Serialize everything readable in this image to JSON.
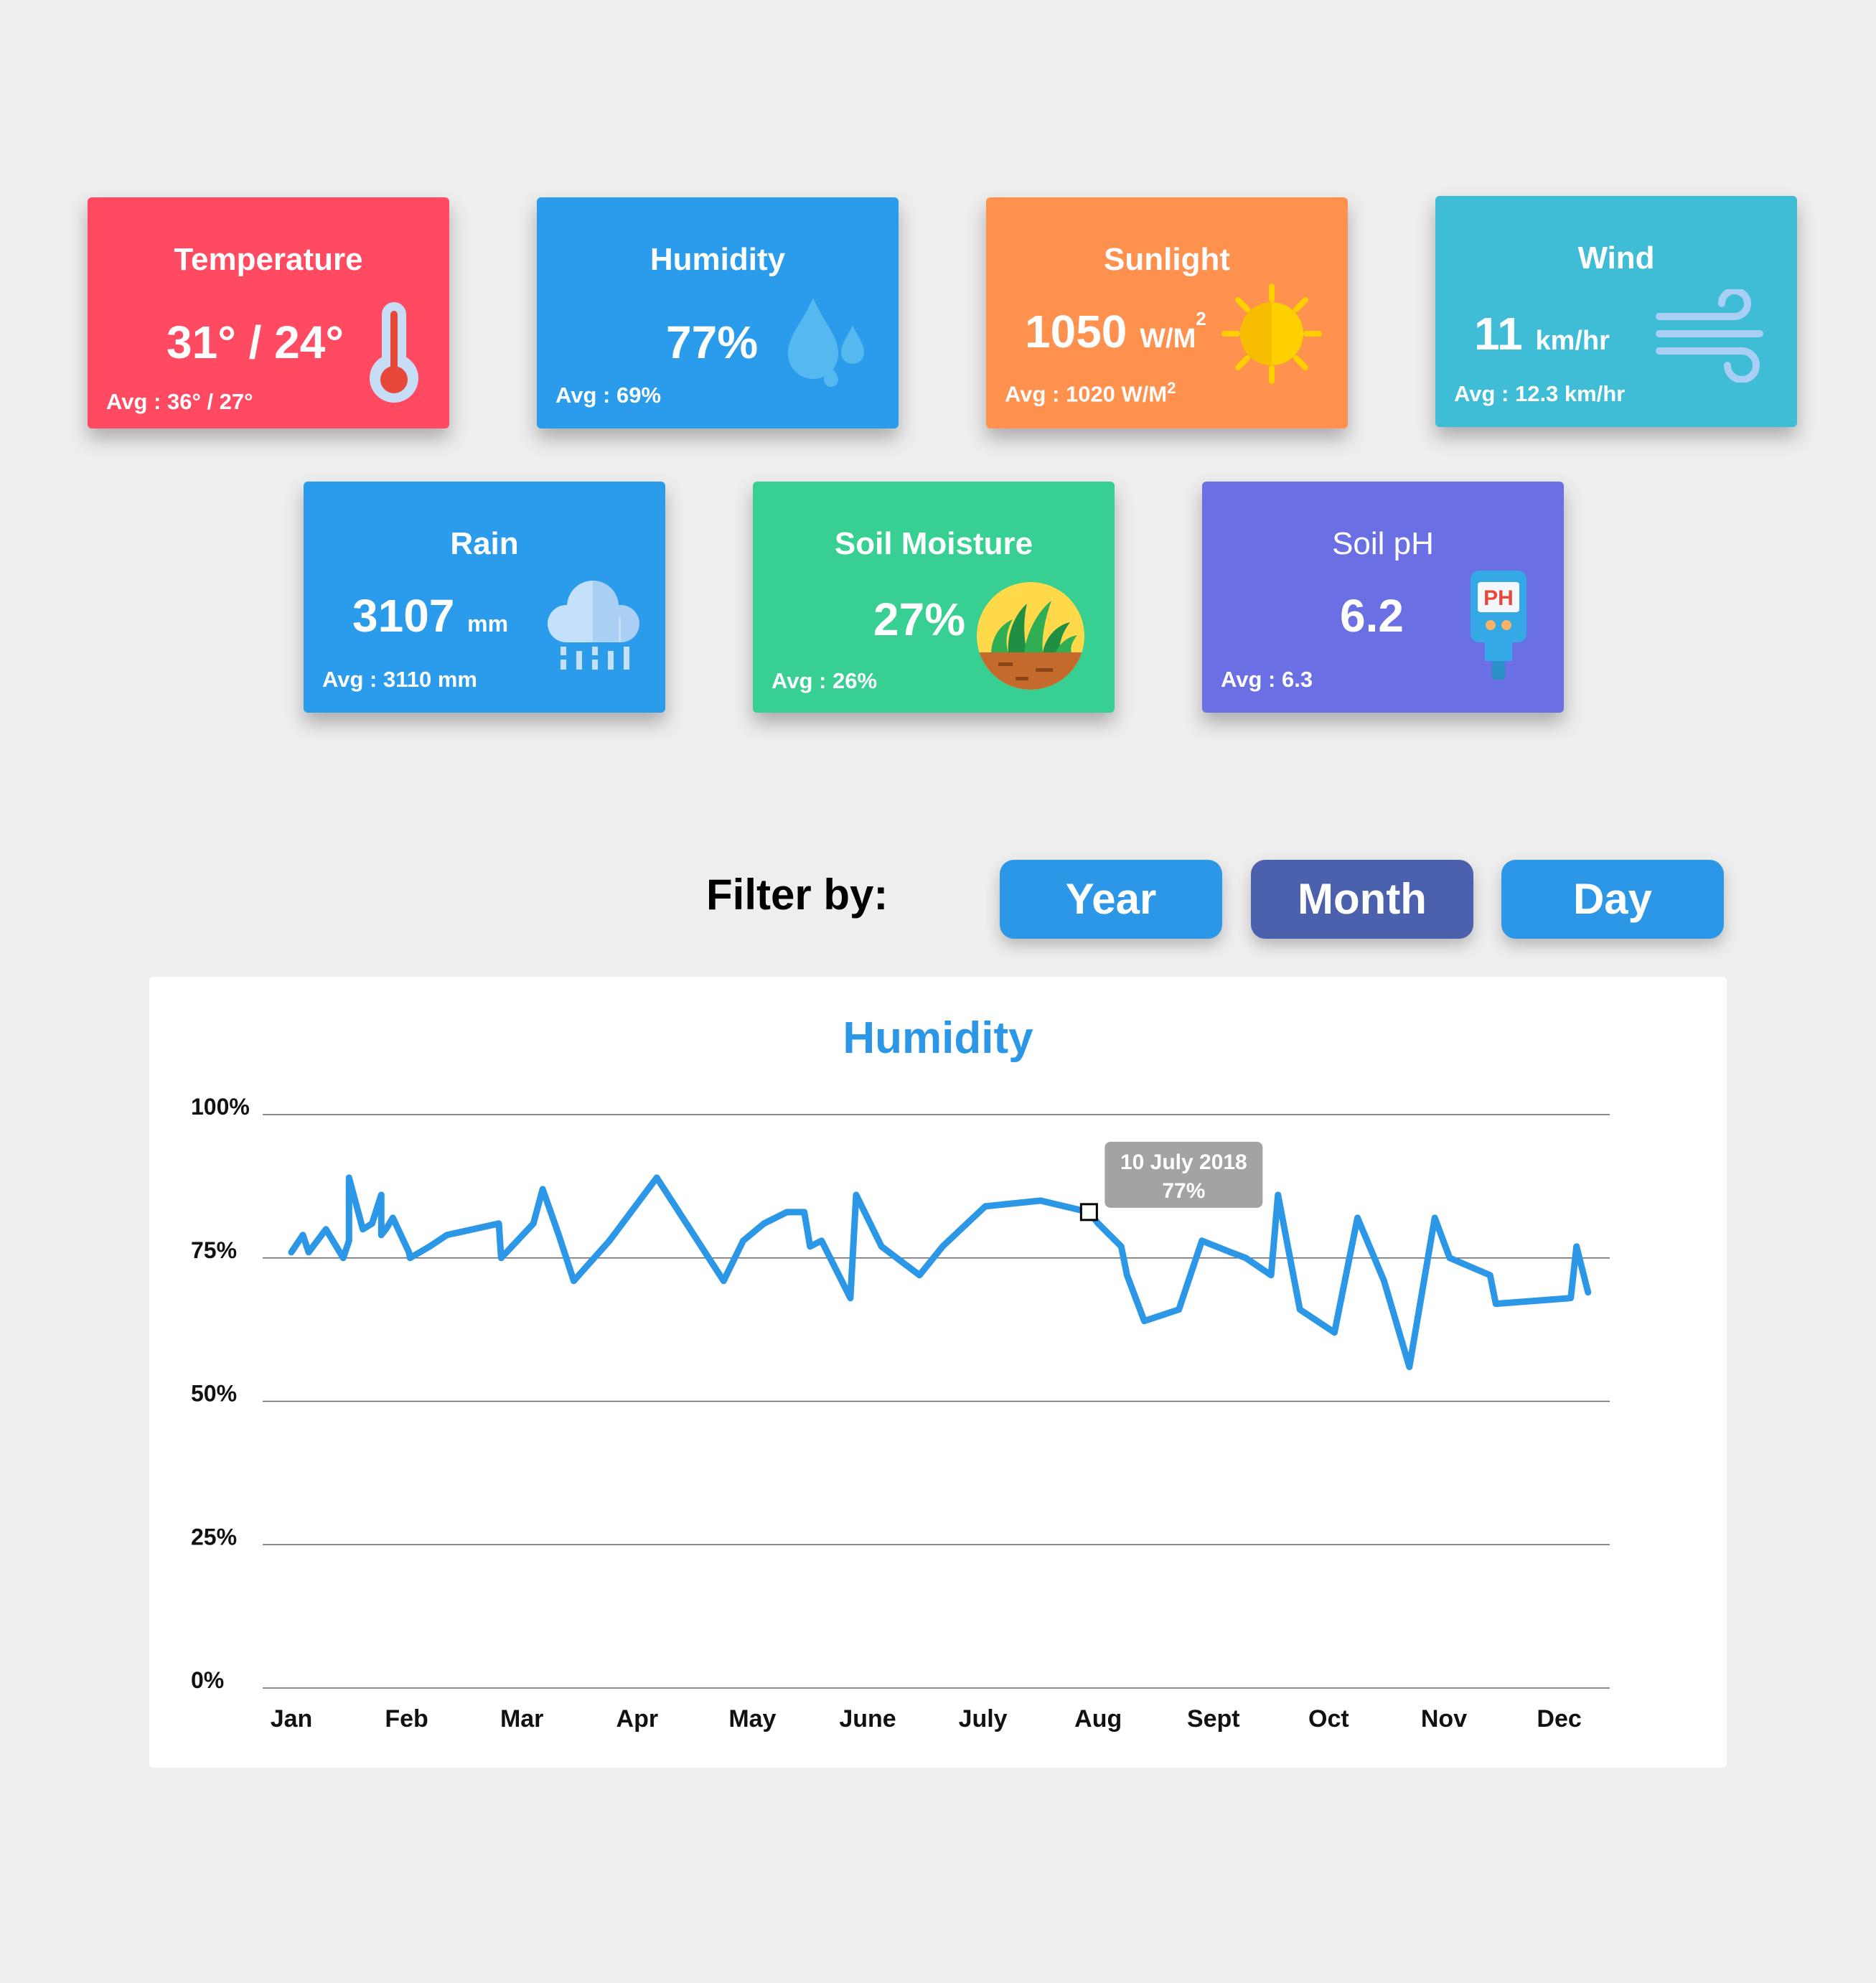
{
  "cards": [
    {
      "title": "Temperature",
      "value": "31° / 24°",
      "unit": "",
      "avg": "Avg : 36° / 27°",
      "icon": "thermometer-icon",
      "color": "#ff4a62"
    },
    {
      "title": "Humidity",
      "value": "77%",
      "unit": "",
      "avg": "Avg : 69%",
      "icon": "water-drops-icon",
      "color": "#2b9bec"
    },
    {
      "title": "Sunlight",
      "value": "1050",
      "unit": "W/M",
      "unit_sup": "2",
      "avg": "Avg :  1020 W/M",
      "avg_sup": "2",
      "icon": "sun-icon",
      "color": "#ff914f"
    },
    {
      "title": "Wind",
      "value": "11",
      "unit": "km/hr",
      "avg": "Avg : 12.3 km/hr",
      "icon": "wind-icon",
      "color": "#3fbdd6"
    },
    {
      "title": "Rain",
      "value": "3107",
      "unit": "mm",
      "avg": "Avg : 3110 mm",
      "icon": "rain-cloud-icon",
      "color": "#2b9bec"
    },
    {
      "title": "Soil Moisture",
      "value": "27%",
      "unit": "",
      "avg": "Avg : 26%",
      "icon": "grass-soil-icon",
      "color": "#37cf92"
    },
    {
      "title": "Soil pH",
      "value": "6.2",
      "unit": "",
      "avg": "Avg : 6.3",
      "icon": "ph-meter-icon",
      "color": "#6a70e3"
    }
  ],
  "filter": {
    "label": "Filter by:",
    "buttons": [
      {
        "label": "Year",
        "color": "#2b97e6",
        "active": false
      },
      {
        "label": "Month",
        "color": "#4b61ad",
        "active": true
      },
      {
        "label": "Day",
        "color": "#2b97e6",
        "active": false
      }
    ]
  },
  "chart_data": {
    "type": "line",
    "title": "Humidity",
    "xlabel": "",
    "ylabel": "",
    "ylim": [
      0,
      100
    ],
    "y_ticks": [
      "0%",
      "25%",
      "50%",
      "75%",
      "100%"
    ],
    "categories": [
      "Jan",
      "Feb",
      "Mar",
      "Apr",
      "May",
      "June",
      "July",
      "Aug",
      "Sept",
      "Oct",
      "Nov",
      "Dec"
    ],
    "grid": true,
    "color": "#2b97e6",
    "series": [
      {
        "x": [
          0,
          0.1,
          0.15,
          0.3,
          0.45,
          0.5,
          0.5,
          0.62,
          0.7,
          0.78,
          0.78,
          0.82,
          0.88,
          1.02,
          1.03,
          1.2,
          1.35,
          1.8,
          1.82,
          2.1,
          2.18,
          2.32,
          2.45,
          2.76,
          3.17,
          3.75,
          3.92,
          4.1,
          4.3,
          4.45,
          4.5,
          4.6,
          4.85,
          4.9,
          5.12,
          5.45,
          5.65,
          6.02,
          6.5,
          6.92,
          7.0,
          7.2,
          7.25,
          7.4,
          7.7,
          7.9,
          8.15,
          8.28,
          8.5,
          8.56,
          8.75,
          9.05,
          9.25,
          9.48,
          9.7,
          9.92,
          10.05,
          10.4,
          10.45,
          11.1,
          11.15,
          11.25
        ],
        "y": [
          76,
          79,
          76,
          80,
          75,
          78,
          89,
          80,
          81,
          86,
          79,
          80,
          82,
          76,
          75,
          77,
          79,
          81,
          75,
          81,
          87,
          79,
          71,
          78,
          89,
          71,
          78,
          81,
          83,
          83,
          77,
          78,
          68,
          86,
          77,
          72,
          77,
          84,
          85,
          83,
          81,
          77,
          72,
          64,
          66,
          78,
          76,
          75,
          72,
          86,
          66,
          62,
          82,
          71,
          56,
          82,
          75,
          72,
          67,
          68,
          77,
          69
        ]
      }
    ],
    "tooltip": {
      "line1": "10 July 2018",
      "line2": "77%",
      "x": 6.92,
      "y": 83
    }
  }
}
